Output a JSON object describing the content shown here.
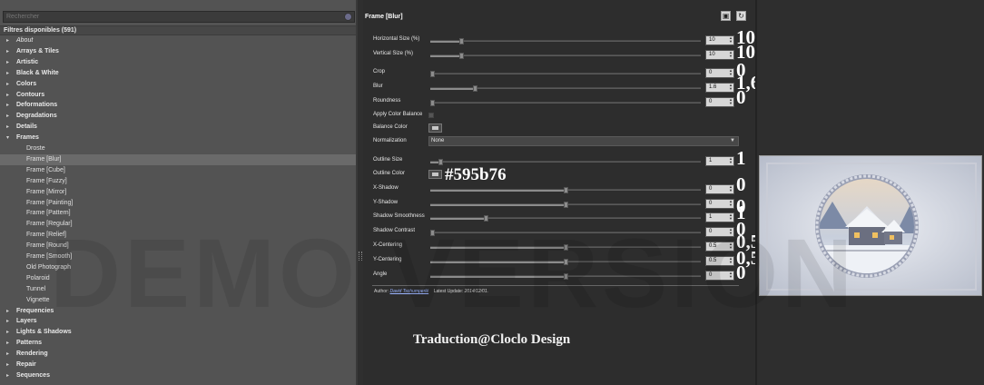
{
  "search": {
    "placeholder": "Rechercher"
  },
  "filter_count": "Filtres disponibles (591)",
  "tree": [
    {
      "label": "About",
      "kind": "cat",
      "italic": true,
      "arrow": "▸"
    },
    {
      "label": "Arrays & Tiles",
      "kind": "cat",
      "arrow": "▸"
    },
    {
      "label": "Artistic",
      "kind": "cat",
      "arrow": "▸"
    },
    {
      "label": "Black & White",
      "kind": "cat",
      "arrow": "▸"
    },
    {
      "label": "Colors",
      "kind": "cat",
      "arrow": "▸"
    },
    {
      "label": "Contours",
      "kind": "cat",
      "arrow": "▸"
    },
    {
      "label": "Deformations",
      "kind": "cat",
      "arrow": "▸"
    },
    {
      "label": "Degradations",
      "kind": "cat",
      "arrow": "▸"
    },
    {
      "label": "Details",
      "kind": "cat",
      "arrow": "▸"
    },
    {
      "label": "Frames",
      "kind": "cat",
      "arrow": "▾"
    },
    {
      "label": "Droste",
      "kind": "child"
    },
    {
      "label": "Frame [Blur]",
      "kind": "child",
      "selected": true
    },
    {
      "label": "Frame [Cube]",
      "kind": "child"
    },
    {
      "label": "Frame [Fuzzy]",
      "kind": "child"
    },
    {
      "label": "Frame [Mirror]",
      "kind": "child"
    },
    {
      "label": "Frame [Painting]",
      "kind": "child"
    },
    {
      "label": "Frame [Pattern]",
      "kind": "child"
    },
    {
      "label": "Frame [Regular]",
      "kind": "child"
    },
    {
      "label": "Frame [Relief]",
      "kind": "child"
    },
    {
      "label": "Frame [Round]",
      "kind": "child"
    },
    {
      "label": "Frame [Smooth]",
      "kind": "child"
    },
    {
      "label": "Old Photograph",
      "kind": "child"
    },
    {
      "label": "Polaroid",
      "kind": "child"
    },
    {
      "label": "Tunnel",
      "kind": "child"
    },
    {
      "label": "Vignette",
      "kind": "child"
    },
    {
      "label": "Frequencies",
      "kind": "cat",
      "arrow": "▸"
    },
    {
      "label": "Layers",
      "kind": "cat",
      "arrow": "▸"
    },
    {
      "label": "Lights & Shadows",
      "kind": "cat",
      "arrow": "▸"
    },
    {
      "label": "Patterns",
      "kind": "cat",
      "arrow": "▸"
    },
    {
      "label": "Rendering",
      "kind": "cat",
      "arrow": "▸"
    },
    {
      "label": "Repair",
      "kind": "cat",
      "arrow": "▸"
    },
    {
      "label": "Sequences",
      "kind": "cat",
      "arrow": "▸"
    }
  ],
  "panel_title": "Frame [Blur]",
  "params": [
    {
      "label": "Horizontal Size (%)",
      "type": "slider",
      "value": "10",
      "fraction": 0.11,
      "annotation": "10"
    },
    {
      "label": "Vertical Size (%)",
      "type": "slider",
      "value": "10",
      "fraction": 0.11,
      "annotation": "10"
    },
    {
      "label": "Crop",
      "type": "slider",
      "value": "0",
      "fraction": 0.0,
      "annotation": "0"
    },
    {
      "label": "Blur",
      "type": "slider",
      "value": "1.6",
      "fraction": 0.16,
      "annotation": "1,6"
    },
    {
      "label": "Roundness",
      "type": "slider",
      "value": "0",
      "fraction": 0.0,
      "annotation": "0"
    },
    {
      "label": "Apply Color Balance",
      "type": "checkbox"
    },
    {
      "label": "Balance Color",
      "type": "color"
    },
    {
      "label": "Normalization",
      "type": "select",
      "value": "None"
    },
    {
      "label": "Outline Size",
      "type": "slider",
      "value": "1",
      "fraction": 0.03,
      "annotation": "1"
    },
    {
      "label": "Outline Color",
      "type": "color",
      "annotation": "#595b76"
    },
    {
      "label": "X-Shadow",
      "type": "slider",
      "value": "0",
      "fraction": 0.5,
      "annotation": "0"
    },
    {
      "label": "Y-Shadow",
      "type": "slider",
      "value": "0",
      "fraction": 0.5,
      "annotation": "0"
    },
    {
      "label": "Shadow Smoothness",
      "type": "slider",
      "value": "1",
      "fraction": 0.2,
      "annotation": "1"
    },
    {
      "label": "Shadow Contrast",
      "type": "slider",
      "value": "0",
      "fraction": 0.0,
      "annotation": "0"
    },
    {
      "label": "X-Centering",
      "type": "slider",
      "value": "0.5",
      "fraction": 0.5,
      "annotation": "0,5"
    },
    {
      "label": "Y-Centering",
      "type": "slider",
      "value": "0.5",
      "fraction": 0.5,
      "annotation": "0,5"
    },
    {
      "label": "Angle",
      "type": "slider",
      "value": "0",
      "fraction": 0.5,
      "annotation": "0"
    }
  ],
  "author": {
    "prefix": "Author:",
    "name": "David Tschumperlé",
    "date_label": "Latest Update:",
    "date": "2014/12/01."
  },
  "watermark": "DEMO VERSION",
  "credit": "Traduction@Cloclo Design",
  "colors": {
    "accent_select": "#6a6a6a",
    "outline_color": "#595b76"
  }
}
